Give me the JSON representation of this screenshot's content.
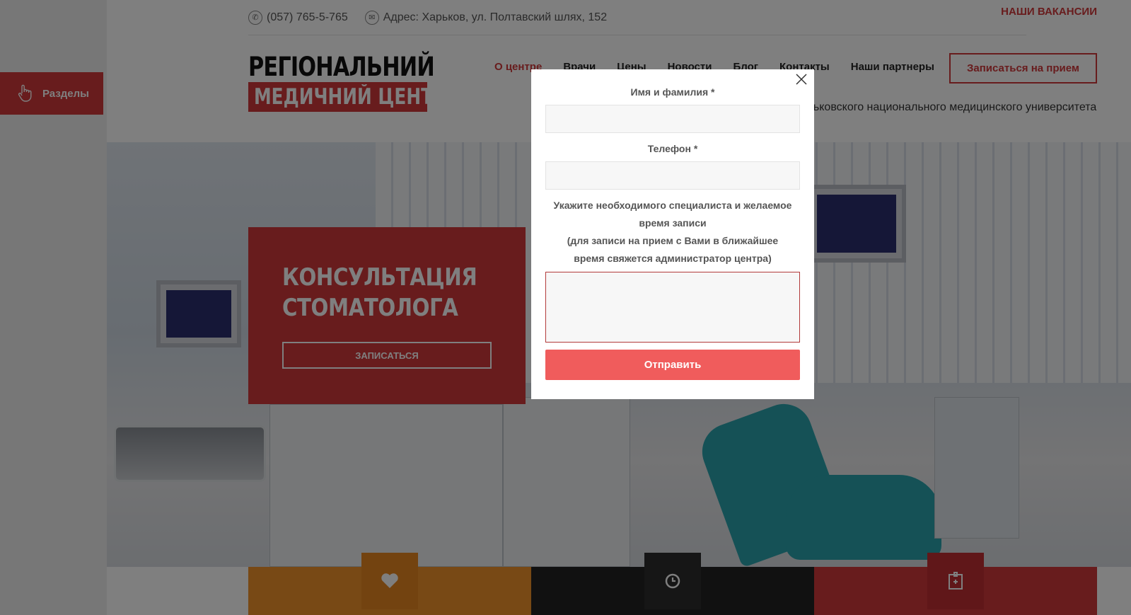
{
  "sidebar": {
    "sections_label": "Разделы"
  },
  "topbar": {
    "phone": "(057) 765-5-765",
    "address": "Адрес: Харьков, ул. Полтавский шлях, 152",
    "vacancies": "НАШИ ВАКАНСИИ"
  },
  "logo": {
    "line1": "РЕГІОНАЛЬНИЙ",
    "line2": "МЕДИЧНИЙ ЦЕНТР"
  },
  "nav": {
    "items": [
      "О центре",
      "Врачи",
      "Цены",
      "Новости",
      "Блог",
      "Контакты",
      "Наши партнеры"
    ],
    "active_index": 0
  },
  "header": {
    "cta_label": "Записаться на прием",
    "tagline": "рьковского национального медицинского университета"
  },
  "hero": {
    "title_line1": "КОНСУЛЬТАЦИЯ",
    "title_line2": "СТОМАТОЛОГА",
    "button_label": "ЗАПИСАТЬСЯ"
  },
  "tiles": [
    {
      "icon": "heart-icon",
      "color": "#f0932b"
    },
    {
      "icon": "clock-icon",
      "color": "#222222"
    },
    {
      "icon": "hospital-icon",
      "color": "#d0383b"
    }
  ],
  "modal": {
    "name_label": "Имя и фамилия *",
    "name_value": "",
    "phone_label": "Телефон *",
    "phone_value": "",
    "note_line1": "Укажите необходимого специалиста и желаемое",
    "note_line2": "время записи",
    "note_line3": "(для записи на прием с Вами в ближайшее",
    "note_line4": "время свяжется администратор центра)",
    "message_value": "",
    "submit_label": "Отправить"
  },
  "colors": {
    "brand_red": "#d0383b",
    "submit": "#f05c5c",
    "orange": "#f0932b"
  }
}
